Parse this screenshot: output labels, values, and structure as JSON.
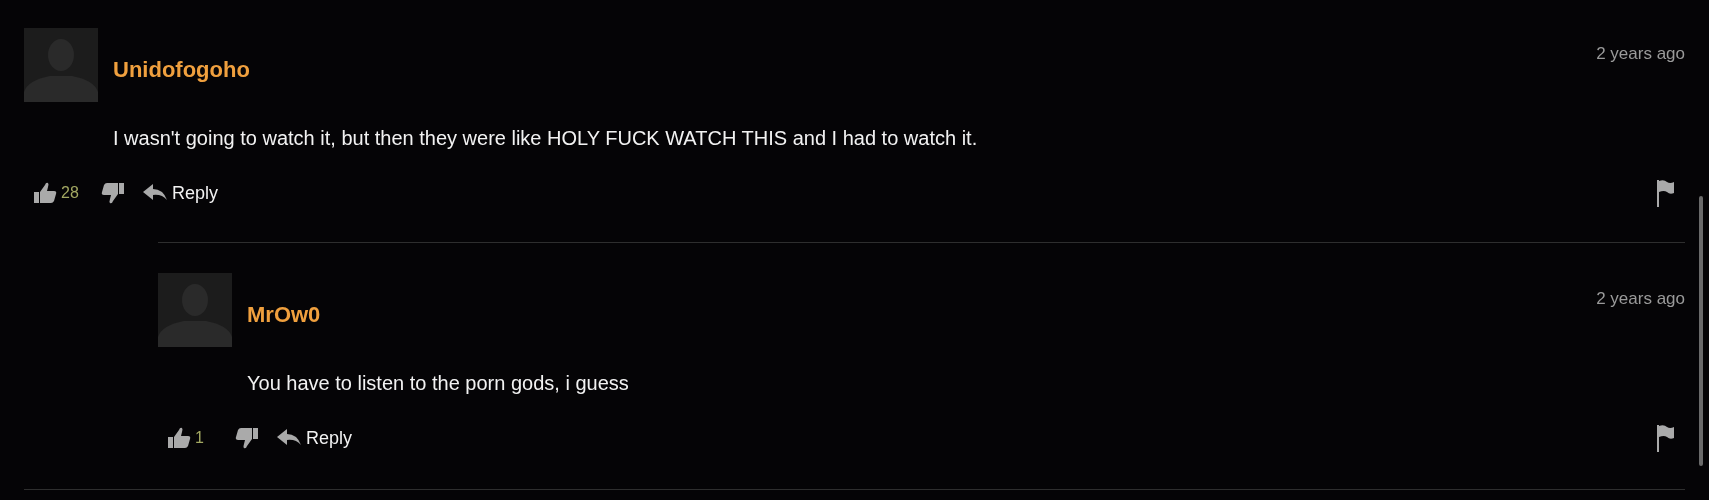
{
  "comments": [
    {
      "author": "Unidofogoho",
      "time": "2 years ago",
      "text": "I wasn't going to watch it, but then they were like HOLY FUCK WATCH THIS and I had to watch it.",
      "likes": "28",
      "reply_label": "Reply",
      "children": [
        {
          "author": "MrOw0",
          "time": "2 years ago",
          "text": "You have to listen to the porn gods, i guess",
          "likes": "1",
          "reply_label": "Reply"
        }
      ]
    }
  ]
}
